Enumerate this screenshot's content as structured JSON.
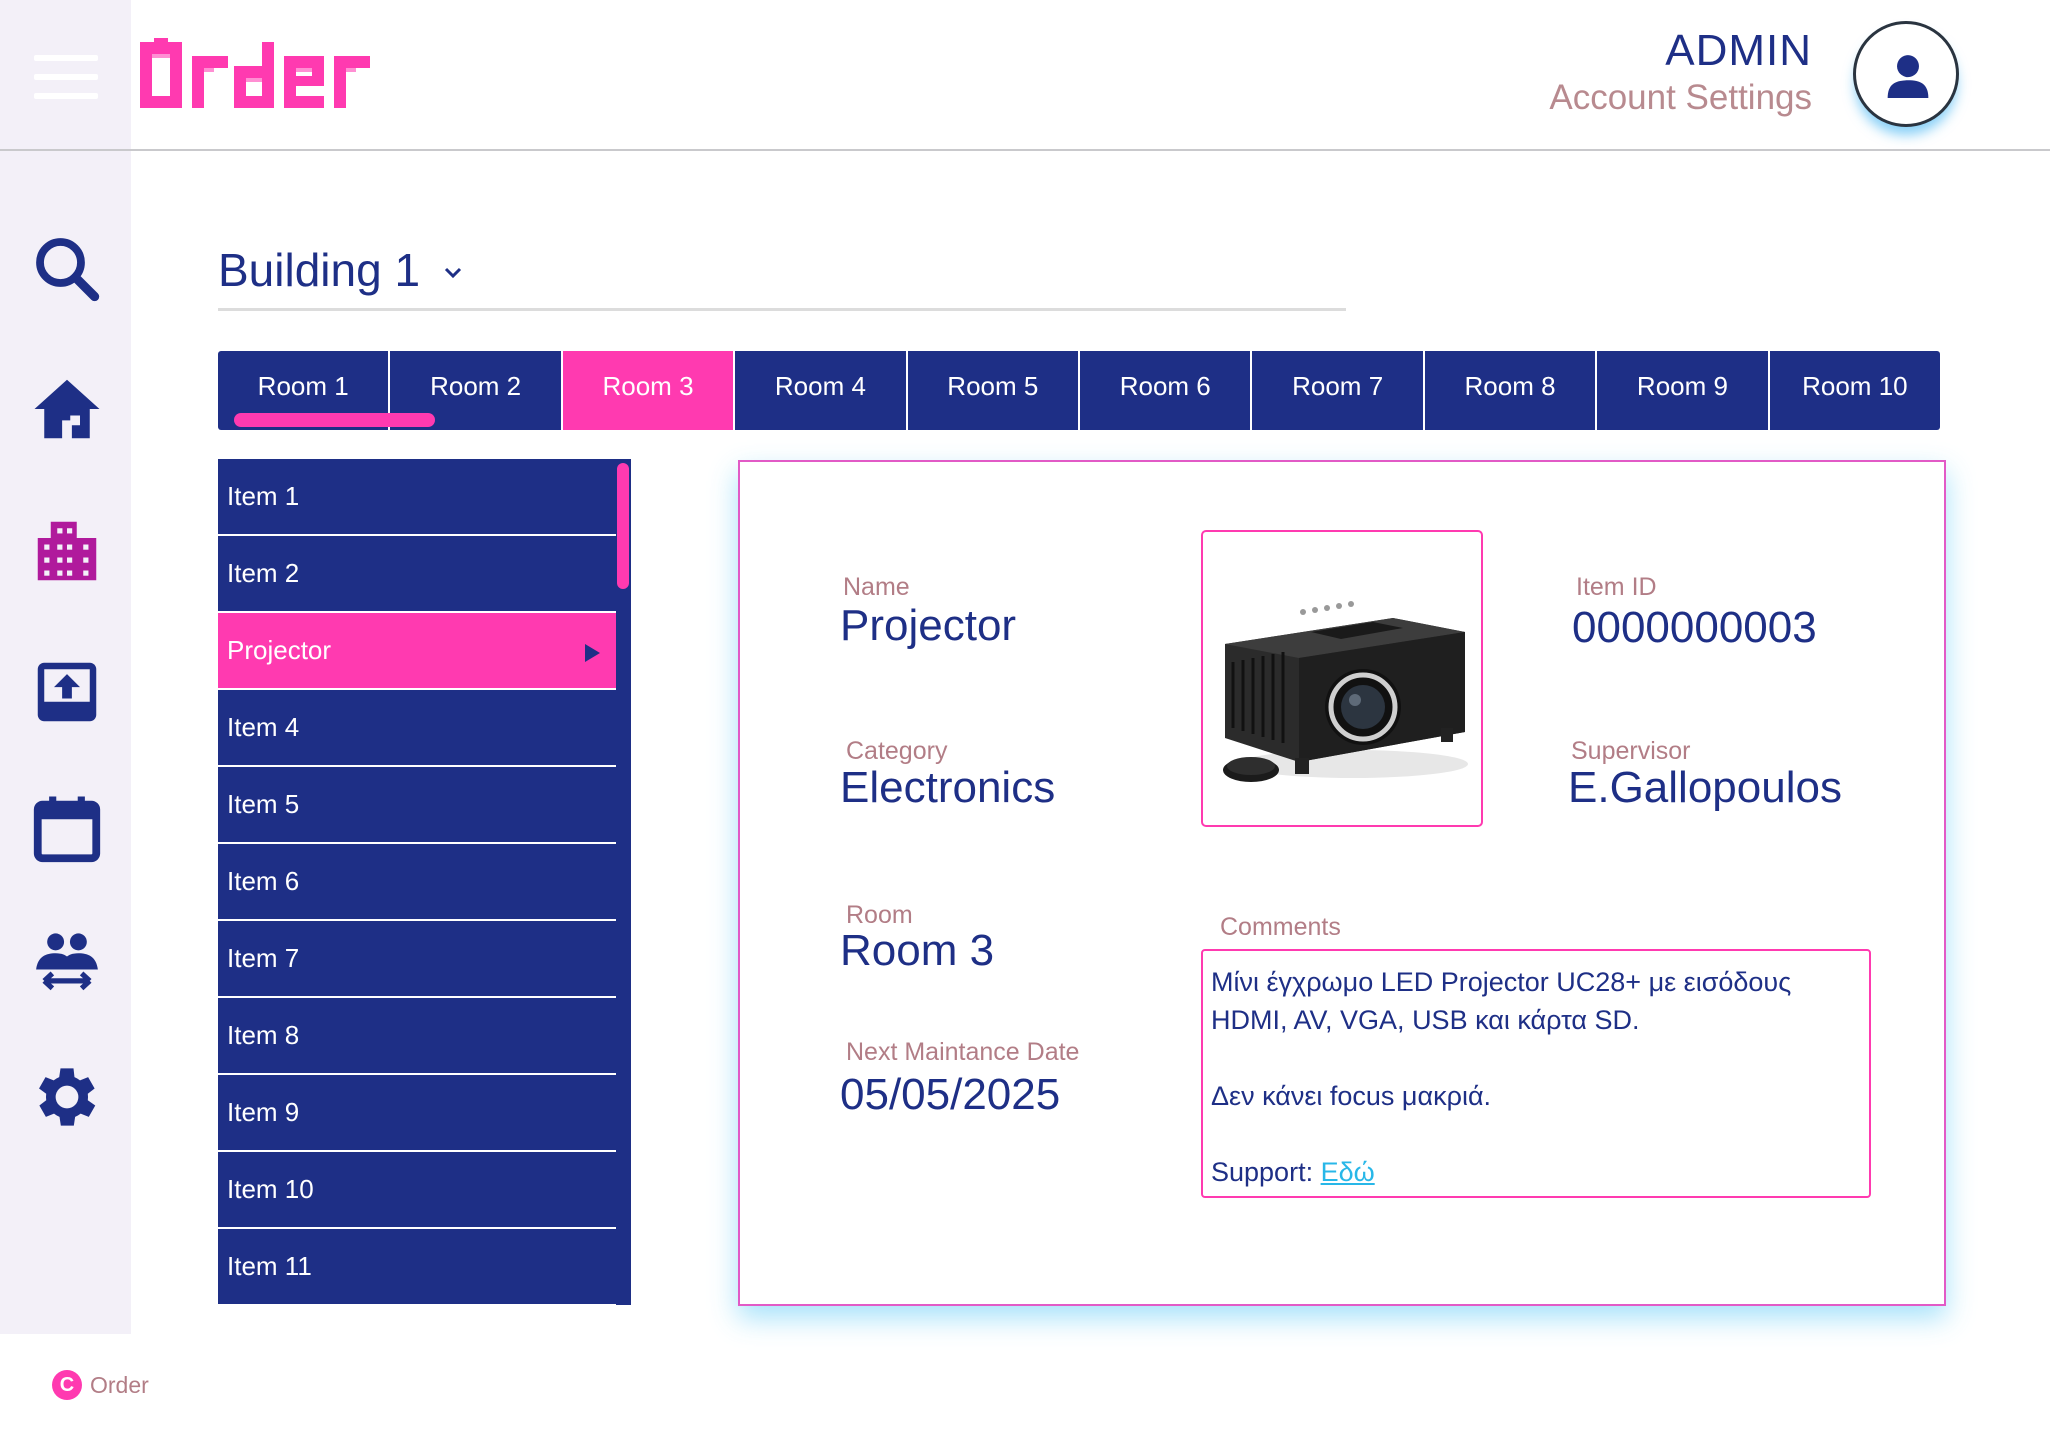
{
  "header": {
    "logo_text": "Order",
    "admin_name": "ADMIN",
    "account_settings": "Account Settings"
  },
  "sidebar": {
    "icons": [
      "search-icon",
      "home-icon",
      "building-icon",
      "upload-icon",
      "calendar-icon",
      "people-swap-icon",
      "gear-icon"
    ]
  },
  "building": {
    "label": "Building 1"
  },
  "rooms": {
    "tabs": [
      "Room 1",
      "Room 2",
      "Room 3",
      "Room 4",
      "Room 5",
      "Room 6",
      "Room 7",
      "Room 8",
      "Room 9",
      "Room 10"
    ],
    "selected": "Room 3"
  },
  "items": {
    "list": [
      "Item 1",
      "Item 2",
      "Projector",
      "Item 4",
      "Item 5",
      "Item 6",
      "Item 7",
      "Item 8",
      "Item 9",
      "Item 10",
      "Item 11"
    ],
    "selected": "Projector"
  },
  "detail": {
    "name_label": "Name",
    "name_value": "Projector",
    "category_label": "Category",
    "category_value": "Electronics",
    "room_label": "Room",
    "room_value": "Room 3",
    "date_label": "Next Maintance Date",
    "date_value": "05/05/2025",
    "item_id_label": "Item ID",
    "item_id_value": "0000000003",
    "supervisor_label": "Supervisor",
    "supervisor_value": "E.Gallopoulos",
    "comments_label": "Comments",
    "comments_line1": "Μίνι έγχρωμο LED Projector UC28+ με εισόδους",
    "comments_line2": "HDMI, AV, VGA, USB και κάρτα SD.",
    "comments_line3": "Δεν κάνει focus μακριά.",
    "support_label": "Support: ",
    "support_link": "Εδώ"
  },
  "footer": {
    "brand": "Order"
  },
  "colors": {
    "navy": "#1e2f86",
    "pink": "#ff3ab0",
    "label": "#b27d86",
    "rail": "#f3f0f8",
    "glow": "#3cbef5"
  }
}
